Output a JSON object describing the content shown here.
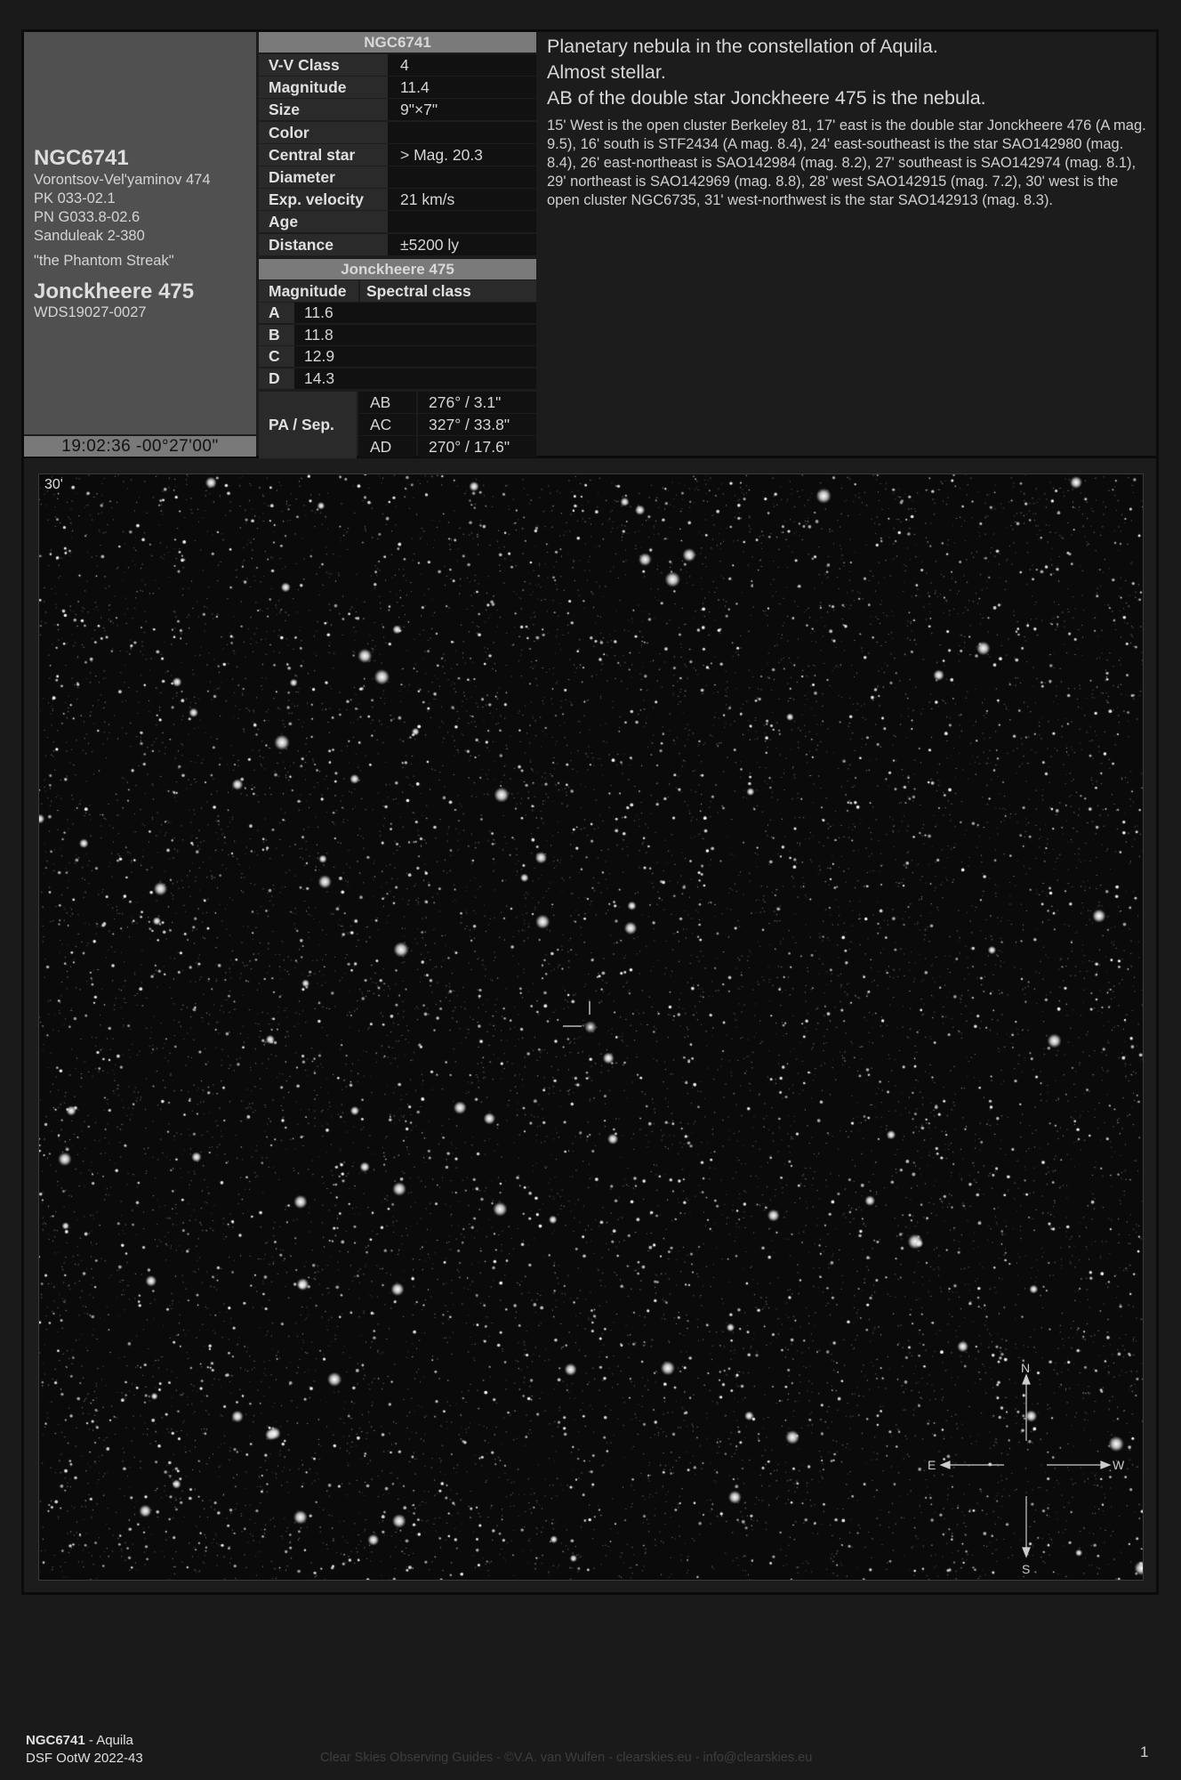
{
  "object": {
    "name": "NGC6741",
    "designations": [
      "Vorontsov-Vel'yaminov 474",
      "PK 033-02.1",
      "PN G033.8-02.6",
      "Sanduleak 2-380"
    ],
    "nickname": "\"the Phantom Streak\"",
    "double_star": "Jonckheere 475",
    "wds": "WDS19027-0027",
    "coordinates": "19:02:36 -00°27'00\""
  },
  "nebula_table": {
    "header": "NGC6741",
    "rows": [
      {
        "key": "V-V Class",
        "value": "4"
      },
      {
        "key": "Magnitude",
        "value": "11.4"
      },
      {
        "key": "Size",
        "value": "9\"×7\""
      },
      {
        "key": "Color",
        "value": ""
      },
      {
        "key": "Central star",
        "value": "> Mag. 20.3"
      },
      {
        "key": "Diameter",
        "value": ""
      },
      {
        "key": "Exp. velocity",
        "value": "21 km/s"
      },
      {
        "key": "Age",
        "value": ""
      },
      {
        "key": "Distance",
        "value": "±5200 ly"
      }
    ]
  },
  "double_table": {
    "header": "Jonckheere 475",
    "col_magnitude": "Magnitude",
    "col_spectral": "Spectral class",
    "components": [
      {
        "label": "A",
        "mag": "11.6",
        "spec": ""
      },
      {
        "label": "B",
        "mag": "11.8",
        "spec": ""
      },
      {
        "label": "C",
        "mag": "12.9",
        "spec": ""
      },
      {
        "label": "D",
        "mag": "14.3",
        "spec": ""
      }
    ],
    "pa_label": "PA / Sep.",
    "pairs": [
      {
        "pair": "AB",
        "value": "276° / 3.1\""
      },
      {
        "pair": "AC",
        "value": "327° / 33.8\""
      },
      {
        "pair": "AD",
        "value": "270° / 17.6\""
      }
    ]
  },
  "description": {
    "line1": "Planetary nebula in the constellation of Aquila.",
    "line2": "Almost stellar.",
    "line3": "AB of the double star Jonckheere 475 is the nebula.",
    "detail": "15' West is the open cluster Berkeley 81, 17' east is the double star Jonckheere 476 (A mag. 9.5), 16' south is STF2434 (A mag. 8.4), 24' east-southeast is the star SAO142980 (mag. 8.4), 26' east-northeast is SAO142984 (mag. 8.2), 27' southeast is SAO142974 (mag. 8.1), 29' northeast is SAO142969 (mag. 8.8), 28' west SAO142915 (mag. 7.2), 30' west is the open cluster NGC6735, 31' west-northwest is the star SAO142913 (mag. 8.3)."
  },
  "photo": {
    "scale_label": "30'",
    "compass": {
      "n": "N",
      "s": "S",
      "e": "E",
      "w": "W"
    }
  },
  "footer": {
    "object": "NGC6741",
    "constellation": " - Aquila",
    "series": "DSF OotW 2022-43",
    "credit": "Clear Skies Observing Guides - ©V.A. van Wulfen - clearskies.eu - info@clearskies.eu",
    "page": "1"
  }
}
